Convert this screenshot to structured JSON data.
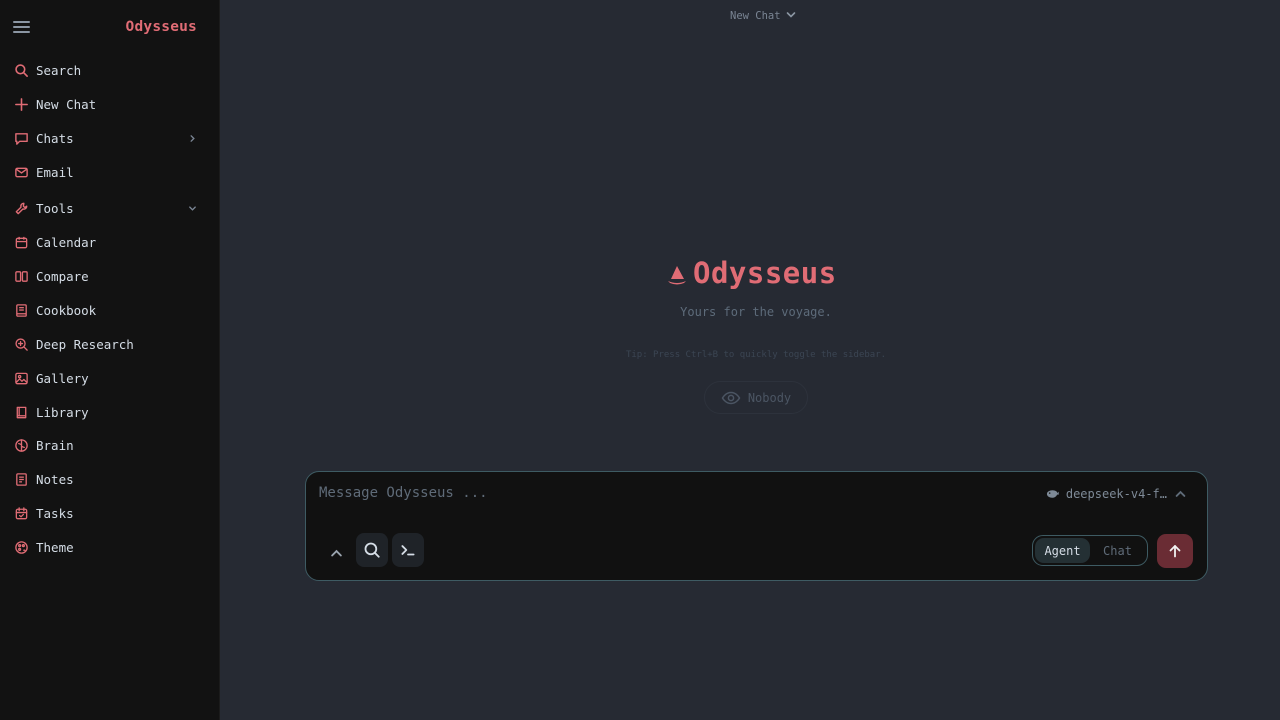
{
  "app": {
    "brand": "Odysseus"
  },
  "sidebar": {
    "items": [
      {
        "label": "Search",
        "icon": "search-icon"
      },
      {
        "label": "New Chat",
        "icon": "plus-icon"
      },
      {
        "label": "Chats",
        "icon": "chat-bubble-icon",
        "expander": "chevron-right-icon"
      },
      {
        "label": "Email",
        "icon": "mail-icon"
      },
      {
        "label": "Tools",
        "icon": "wrench-icon",
        "expander": "chevron-down-icon"
      },
      {
        "label": "Calendar",
        "icon": "calendar-icon"
      },
      {
        "label": "Compare",
        "icon": "columns-icon"
      },
      {
        "label": "Cookbook",
        "icon": "book-icon"
      },
      {
        "label": "Deep Research",
        "icon": "zoom-search-icon"
      },
      {
        "label": "Gallery",
        "icon": "image-icon"
      },
      {
        "label": "Library",
        "icon": "library-book-icon"
      },
      {
        "label": "Brain",
        "icon": "brain-icon"
      },
      {
        "label": "Notes",
        "icon": "notes-icon"
      },
      {
        "label": "Tasks",
        "icon": "calendar-check-icon"
      },
      {
        "label": "Theme",
        "icon": "palette-icon"
      }
    ]
  },
  "main": {
    "chat_title": "New Chat",
    "hero_name": "Odysseus",
    "tagline": "Yours for the voyage.",
    "tip": "Tip: Press Ctrl+B to quickly toggle the sidebar.",
    "visibility_label": "Nobody"
  },
  "composer": {
    "placeholder": "Message Odysseus ...",
    "model": "deepseek-v4-f…",
    "modes": [
      "Agent",
      "Chat"
    ],
    "active_mode": "Agent"
  },
  "colors": {
    "accent": "#e06c75",
    "sidebar_bg": "#121212",
    "main_bg": "#262a33",
    "composer_border": "#3e5b63",
    "send_bg": "#6a2c34"
  }
}
